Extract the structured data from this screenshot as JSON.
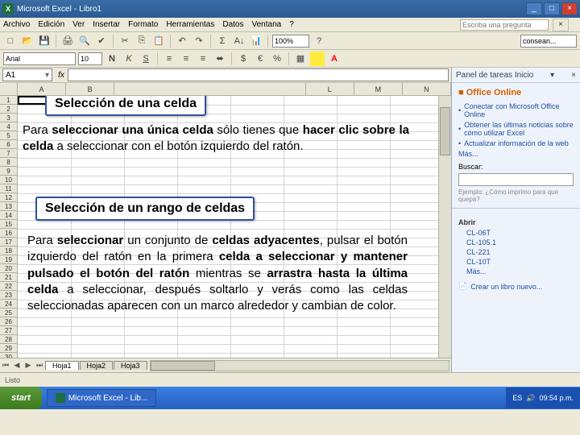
{
  "titlebar": {
    "app": "Microsoft Excel",
    "doc": "Libro1"
  },
  "menu": {
    "file": "Archivo",
    "edit": "Edición",
    "view": "Ver",
    "insert": "Insertar",
    "format": "Formato",
    "tools": "Herramientas",
    "data": "Datos",
    "window": "Ventana",
    "help": "?",
    "helpbox": "Escriba una pregunta"
  },
  "toolbar": {
    "zoom": "100%"
  },
  "format": {
    "font": "Arial",
    "size": "10",
    "cond": "consean..."
  },
  "namebox": "A1",
  "columns": [
    "A",
    "B",
    "L",
    "M",
    "N"
  ],
  "callout1": "Selección de una celda",
  "explain1_a": "Para ",
  "explain1_b": "seleccionar una única celda",
  "explain1_c": " sólo tienes que ",
  "explain1_d": "hacer clic sobre la celda",
  "explain1_e": " a seleccionar con el botón izquierdo del ratón.",
  "callout2": "Selección de un rango de celdas",
  "explain2_a": "Para ",
  "explain2_b": "seleccionar",
  "explain2_c": " un conjunto de ",
  "explain2_d": "celdas adyacentes",
  "explain2_e": ", pulsar el botón izquierdo del ratón en la primera ",
  "explain2_f": "celda a seleccionar y mantener pulsado el botón del ratón",
  "explain2_g": " mientras se ",
  "explain2_h": "arrastra hasta la última celda",
  "explain2_i": " a seleccionar, después soltarlo y verás como las celdas seleccionadas aparecen con un marco alrededor y cambian de color.",
  "sheets": {
    "s1": "Hoja1",
    "s2": "Hoja2",
    "s3": "Hoja3"
  },
  "taskpane": {
    "title": "Panel de tareas Inicio",
    "office": "Office Online",
    "l1": "Conectar con Microsoft Office Online",
    "l2": "Obtener las últimas noticias sobre cómo utilizar Excel",
    "l3": "Actualizar información de la web",
    "l4": "Más...",
    "search": "Buscar:",
    "example": "Ejemplo: ¿Cómo imprimo para que quepa?",
    "open": "Abrir",
    "f1": "CL-06T",
    "f2": "CL-105.1",
    "f3": "CL-221",
    "f4": "CL-10T",
    "f5": "Más...",
    "new": "Crear un libro nuevo..."
  },
  "start": "start",
  "taskitems": {
    "excel": "Microsoft Excel - Lib..."
  },
  "tray": {
    "lang": "ES",
    "time": "09:54 p.m."
  },
  "status": "Listo"
}
